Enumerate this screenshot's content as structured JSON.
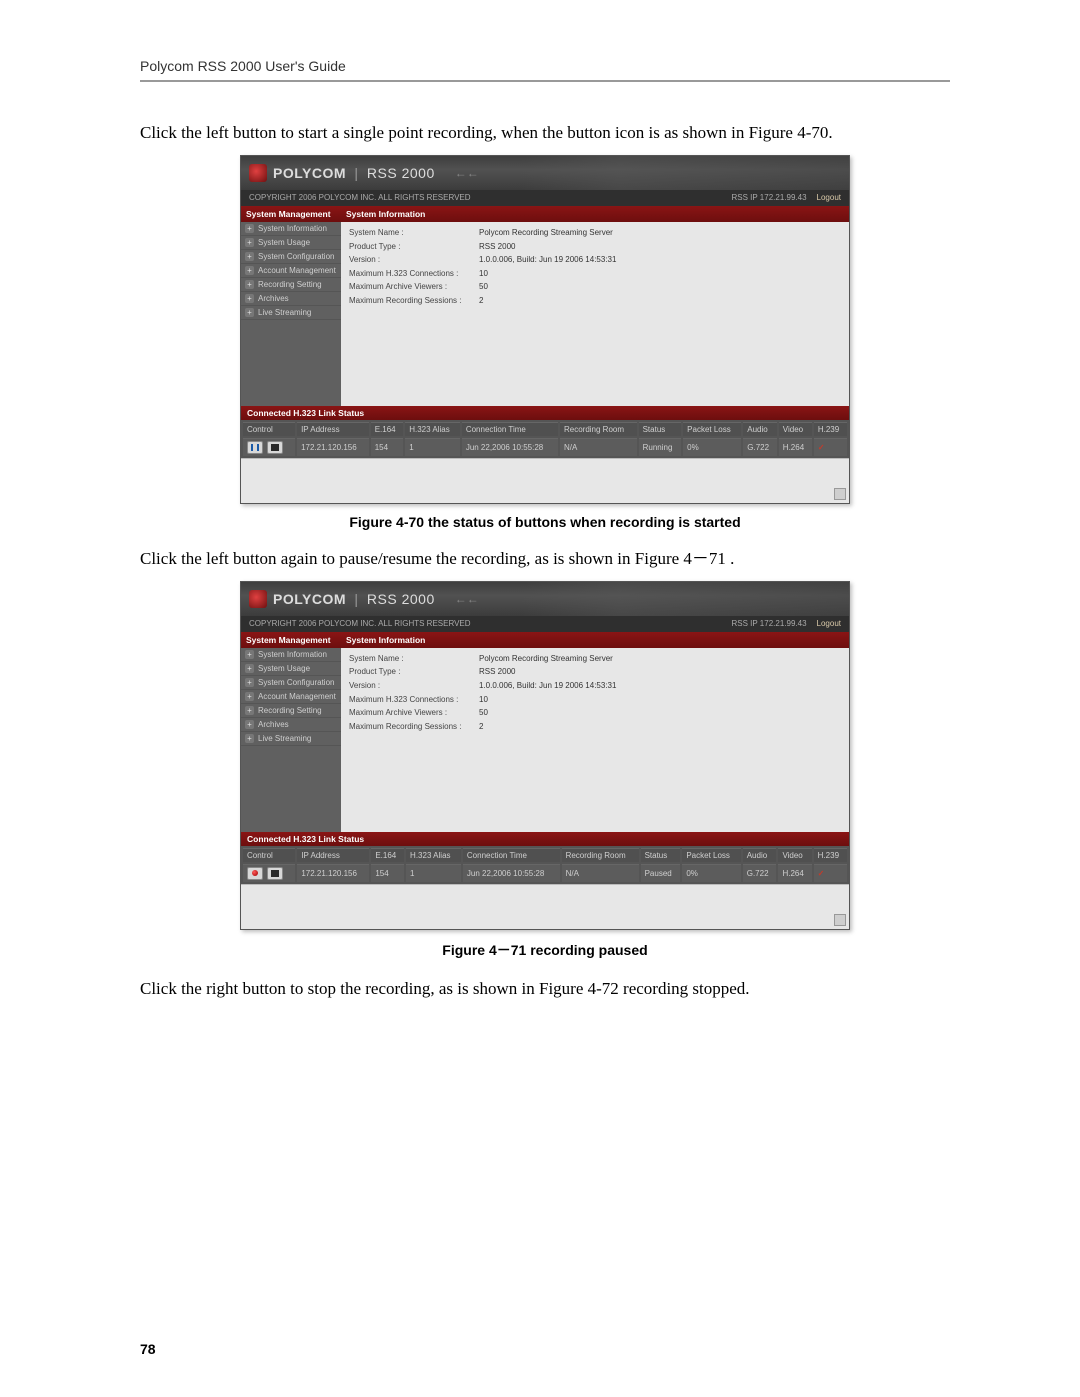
{
  "header": {
    "running": "Polycom RSS 2000 User's Guide"
  },
  "text": {
    "p1": "Click the left button to start a single point recording, when the button icon is as shown in Figure 4-70.",
    "caption1": "Figure 4-70 the status of buttons when recording is started",
    "p2": "Click the left button again to pause/resume the recording, as is shown in Figure 4－71 .",
    "caption2": "Figure 4－71 recording paused",
    "p3": "Click the right button to stop the recording, as is shown in Figure 4-72 recording stopped."
  },
  "page_number": "78",
  "app": {
    "brand": "POLYCOM",
    "product": "RSS 2000",
    "copyright": "COPYRIGHT  2006  POLYCOM  INC.  ALL RIGHTS RESERVED",
    "rss_ip_label": "RSS IP 172.21.99.43",
    "logout": "Logout",
    "sidebar_header": "System Management",
    "sidebar_items": [
      "System Information",
      "System Usage",
      "System Configuration",
      "Account Management",
      "Recording Setting",
      "Archives",
      "Live Streaming"
    ],
    "content_header": "System Information",
    "info": [
      {
        "k": "System Name :",
        "v": "Polycom Recording Streaming Server"
      },
      {
        "k": "Product Type :",
        "v": "RSS 2000"
      },
      {
        "k": "Version :",
        "v": "1.0.0.006, Build: Jun 19 2006 14:53:31"
      },
      {
        "k": "Maximum H.323 Connections :",
        "v": "10"
      },
      {
        "k": "Maximum Archive Viewers :",
        "v": "50"
      },
      {
        "k": "Maximum Recording Sessions :",
        "v": "2"
      }
    ],
    "link_status_header": "Connected H.323 Link Status",
    "columns": [
      "Control",
      "IP Address",
      "E.164",
      "H.323 Alias",
      "Connection Time",
      "Recording Room",
      "Status",
      "Packet Loss",
      "Audio",
      "Video",
      "H.239"
    ],
    "screens": [
      {
        "control_icons": [
          "pause",
          "stop"
        ],
        "row": {
          "ip": "172.21.120.156",
          "e164": "154",
          "alias": "1",
          "conn_time": "Jun 22,2006 10:55:28",
          "room": "N/A",
          "status": "Running",
          "loss": "0%",
          "audio": "G.722",
          "video": "H.264",
          "h239": "✓"
        }
      },
      {
        "control_icons": [
          "rec",
          "stop"
        ],
        "row": {
          "ip": "172.21.120.156",
          "e164": "154",
          "alias": "1",
          "conn_time": "Jun 22,2006 10:55:28",
          "room": "N/A",
          "status": "Paused",
          "loss": "0%",
          "audio": "G.722",
          "video": "H.264",
          "h239": "✓"
        }
      }
    ]
  }
}
